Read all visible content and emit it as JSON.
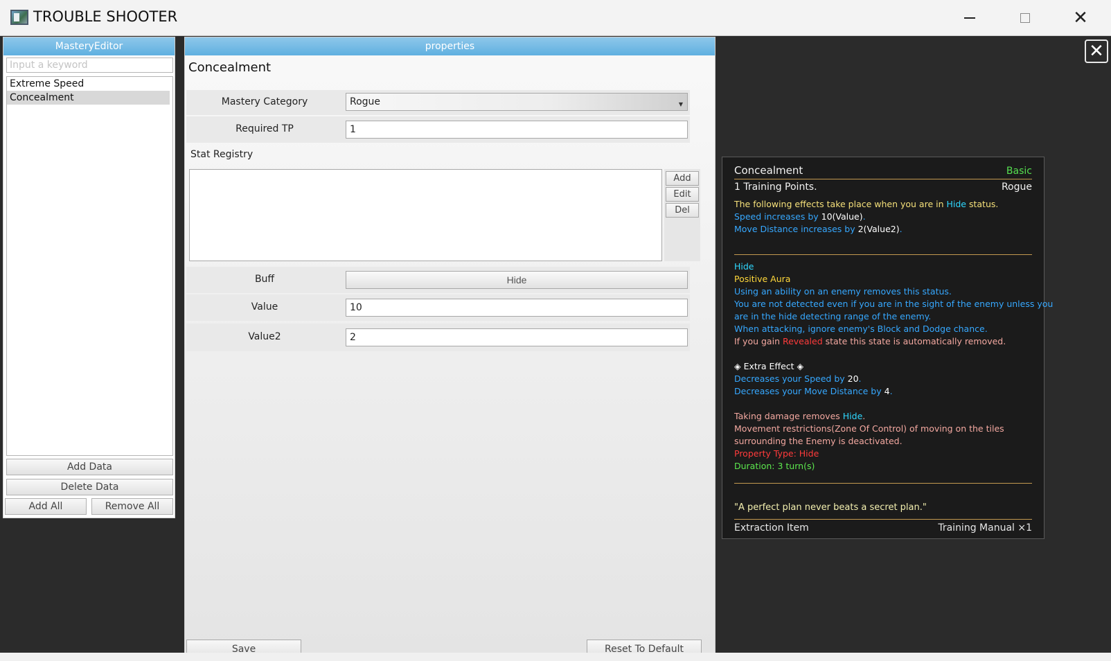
{
  "window": {
    "title": "TROUBLE SHOOTER"
  },
  "left_panel": {
    "header": "MasteryEditor",
    "search_placeholder": "Input a keyword",
    "items": [
      {
        "label": "Extreme Speed",
        "selected": false
      },
      {
        "label": "Concealment",
        "selected": true
      }
    ],
    "buttons": {
      "add_data": "Add Data",
      "delete_data": "Delete Data",
      "add_all": "Add All",
      "remove_all": "Remove All"
    }
  },
  "properties": {
    "header": "properties",
    "title": "Concealment",
    "mastery_category_label": "Mastery Category",
    "mastery_category_value": "Rogue",
    "required_tp_label": "Required TP",
    "required_tp_value": "1",
    "stat_registry_label": "Stat Registry",
    "stat_buttons": {
      "add": "Add",
      "edit": "Edit",
      "del": "Del"
    },
    "buff_label": "Buff",
    "buff_value": "Hide",
    "value_label": "Value",
    "value_value": "10",
    "value2_label": "Value2",
    "value2_value": "2",
    "save_label": "Save",
    "reset_label": "Reset To Default"
  },
  "tooltip": {
    "name": "Concealment",
    "grade": "Basic",
    "training_points": "1 Training Points.",
    "category": "Rogue",
    "desc": {
      "l1a": "The following effects take place when you are in ",
      "l1b": "Hide",
      "l1c": " status.",
      "l2a": "Speed increases by ",
      "l2b": "10(Value)",
      "l2c": ".",
      "l3a": "Move Distance increases by ",
      "l3b": "2(Value2)",
      "l3c": "."
    },
    "buff": {
      "name": "Hide",
      "type": "Positive Aura",
      "e1": "Using an ability on an enemy removes this status.",
      "e2": "You are not detected even if you are in the sight of the enemy unless you",
      "e3": "are in the hide detecting range of the enemy.",
      "e4": "When attacking, ignore enemy's Block and Dodge chance.",
      "e5a": "If you gain ",
      "e5b": "Revealed",
      "e5c": " state this state is automatically removed.",
      "extra_title": "◈ Extra Effect ◈",
      "x1a": "Decreases your Speed by ",
      "x1b": "20",
      "x1c": ".",
      "x2a": "Decreases your Move Distance by ",
      "x2b": "4",
      "x2c": ".",
      "d1a": "Taking damage removes ",
      "d1b": "Hide",
      "d1c": ".",
      "d2": "Movement restrictions(Zone Of Control) of moving on the tiles",
      "d3": "surrounding the Enemy is deactivated.",
      "property_type": "Property Type: Hide",
      "duration": "Duration: 3 turn(s)"
    },
    "quote": "\"A perfect plan never beats a secret plan.\"",
    "footer_left": "Extraction Item",
    "footer_right": "Training Manual ×1"
  }
}
